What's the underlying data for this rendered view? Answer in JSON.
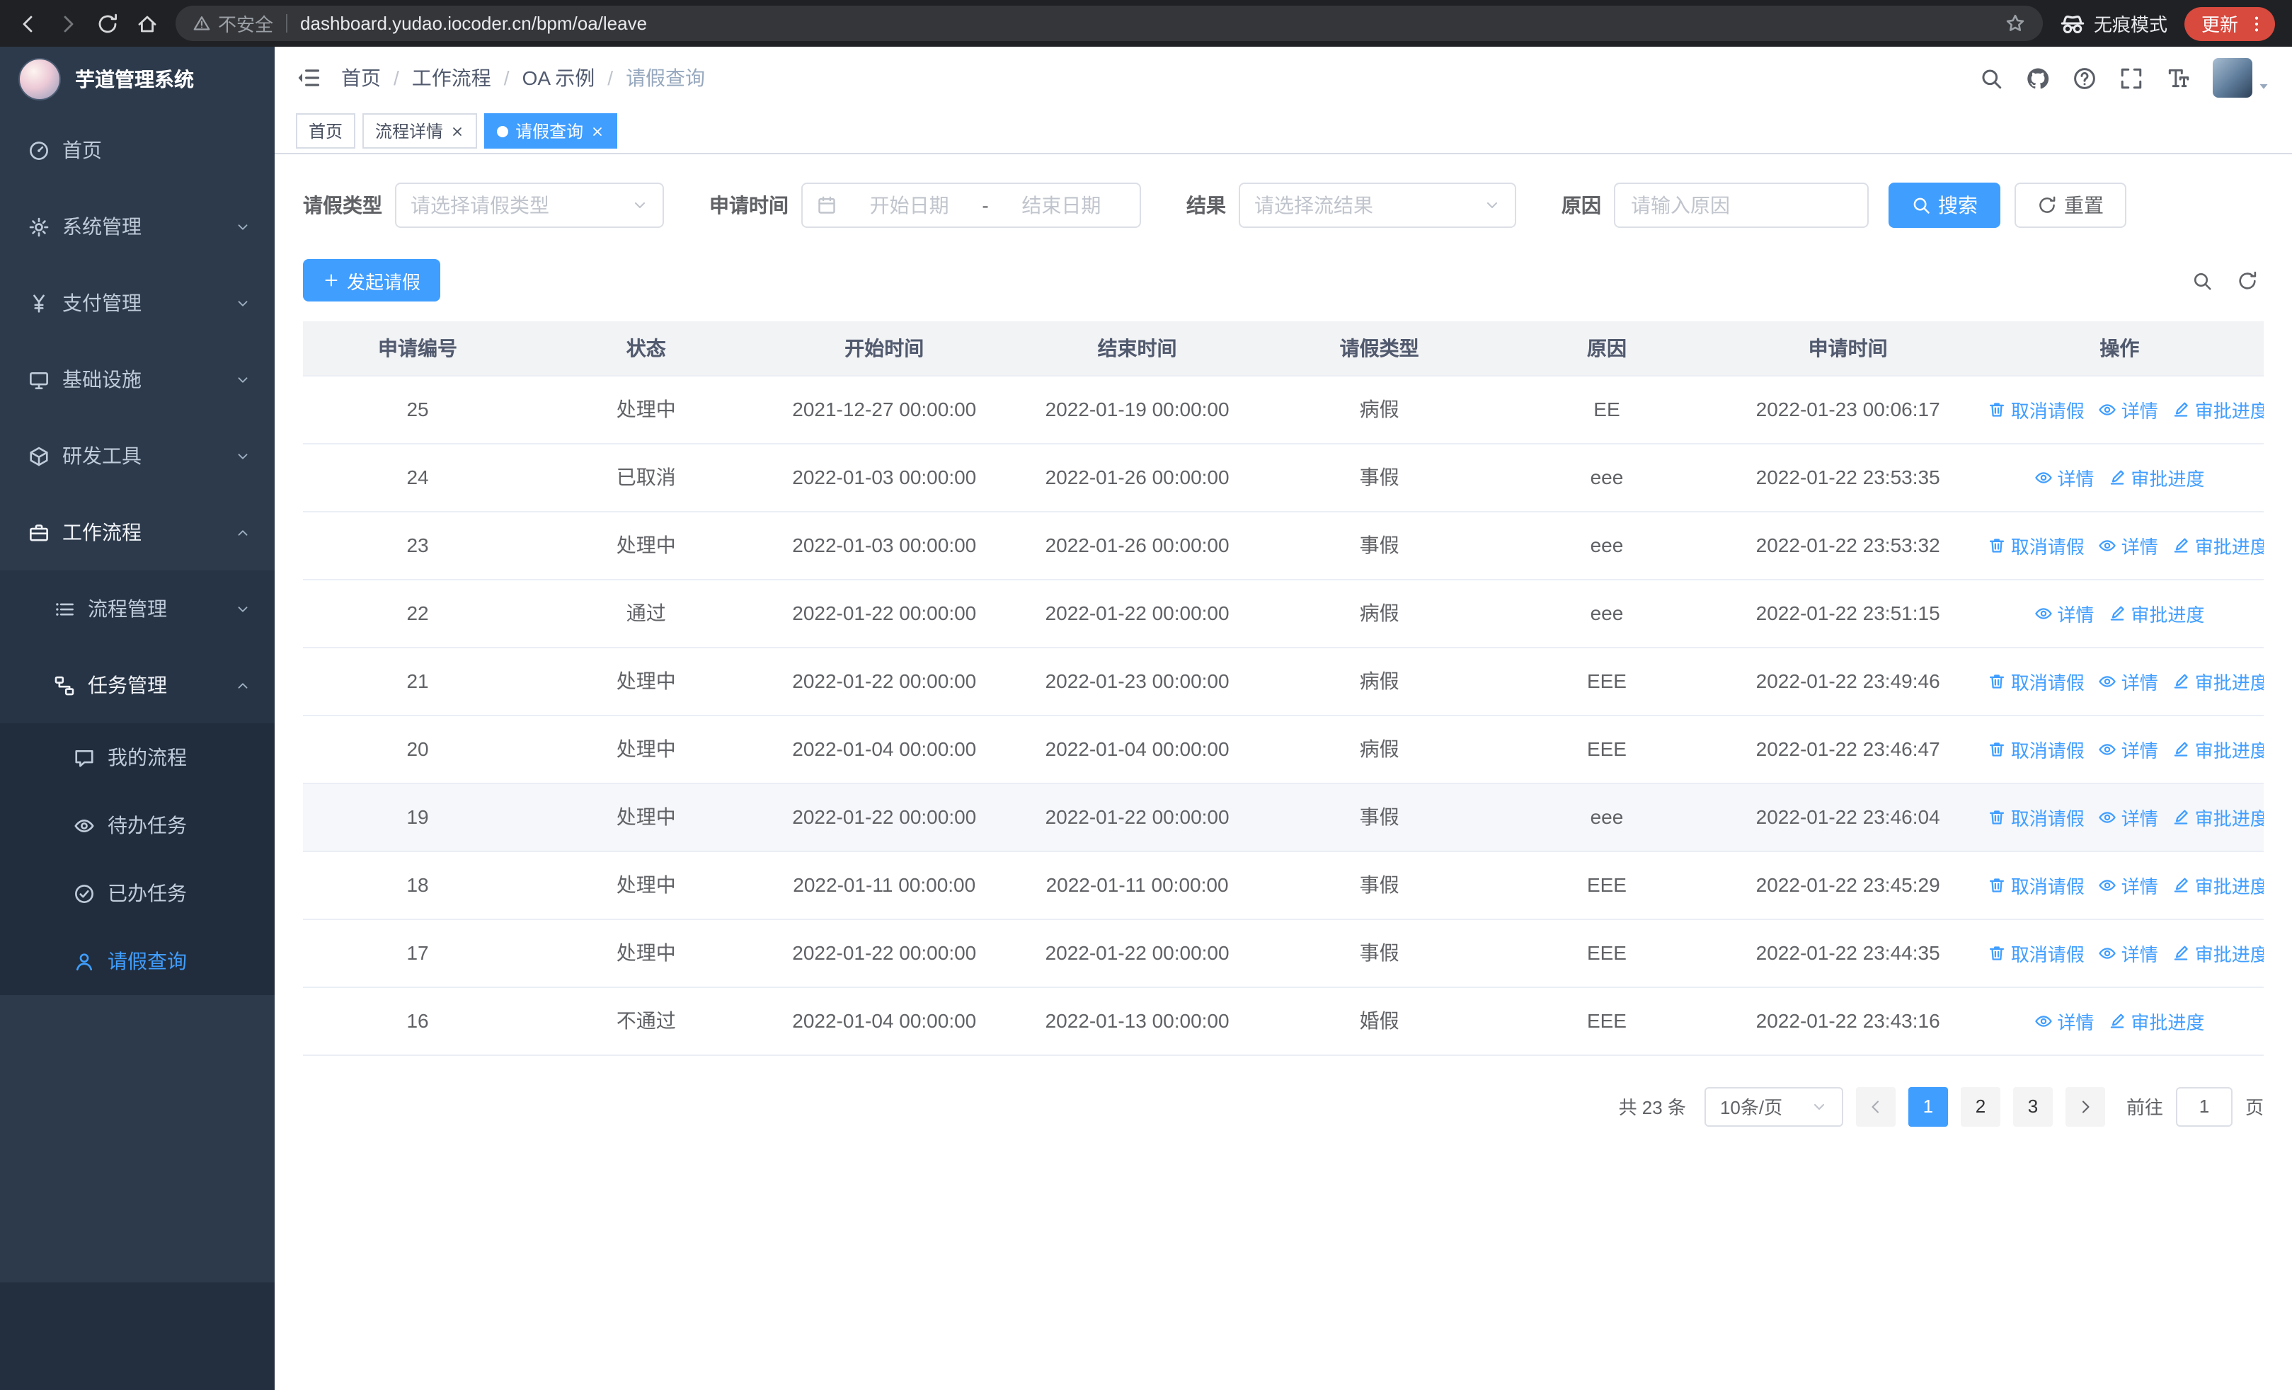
{
  "colors": {
    "primary": "#409eff",
    "sidebar_bg": "#2d3a4b"
  },
  "browser": {
    "security_label": "不安全",
    "url": "dashboard.yudao.iocoder.cn/bpm/oa/leave",
    "incognito_label": "无痕模式",
    "update_label": "更新"
  },
  "sidebar": {
    "title": "芋道管理系统",
    "items": [
      {
        "label": "首页",
        "icon": "dashboard",
        "depth": 1
      },
      {
        "label": "系统管理",
        "icon": "gear",
        "depth": 1,
        "chevron": "down"
      },
      {
        "label": "支付管理",
        "icon": "yen",
        "depth": 1,
        "chevron": "down"
      },
      {
        "label": "基础设施",
        "icon": "monitor",
        "depth": 1,
        "chevron": "down"
      },
      {
        "label": "研发工具",
        "icon": "cube",
        "depth": 1,
        "chevron": "down"
      },
      {
        "label": "工作流程",
        "icon": "briefcase",
        "depth": 1,
        "chevron": "up",
        "open": true
      },
      {
        "label": "流程管理",
        "icon": "list",
        "depth": 2,
        "chevron": "down"
      },
      {
        "label": "任务管理",
        "icon": "flow",
        "depth": 2,
        "chevron": "up",
        "open": true
      },
      {
        "label": "我的流程",
        "icon": "chat",
        "depth": 3
      },
      {
        "label": "待办任务",
        "icon": "eye",
        "depth": 3
      },
      {
        "label": "已办任务",
        "icon": "check",
        "depth": 3
      },
      {
        "label": "请假查询",
        "icon": "user",
        "depth": 3,
        "active": true
      }
    ]
  },
  "header": {
    "separator": "/",
    "breadcrumb": [
      {
        "label": "首页"
      },
      {
        "label": "工作流程"
      },
      {
        "label": "OA 示例"
      },
      {
        "label": "请假查询",
        "current": true
      }
    ]
  },
  "tabs": [
    {
      "label": "首页"
    },
    {
      "label": "流程详情",
      "closable": true
    },
    {
      "label": "请假查询",
      "closable": true,
      "active": true
    }
  ],
  "filters": {
    "leave_type_label": "请假类型",
    "leave_type_placeholder": "请选择请假类型",
    "apply_time_label": "申请时间",
    "start_placeholder": "开始日期",
    "range_separator": "-",
    "end_placeholder": "结束日期",
    "result_label": "结果",
    "result_placeholder": "请选择流结果",
    "reason_label": "原因",
    "reason_placeholder": "请输入原因",
    "search_label": "搜索",
    "reset_label": "重置"
  },
  "toolbar": {
    "create_label": "发起请假"
  },
  "table": {
    "columns": [
      "申请编号",
      "状态",
      "开始时间",
      "结束时间",
      "请假类型",
      "原因",
      "申请时间",
      "操作"
    ],
    "action_labels": {
      "cancel": "取消请假",
      "detail": "详情",
      "progress": "审批进度"
    },
    "rows": [
      {
        "id": "25",
        "status": "处理中",
        "start": "2021-12-27 00:00:00",
        "end": "2022-01-19 00:00:00",
        "type": "病假",
        "reason": "EE",
        "applied": "2022-01-23 00:06:17",
        "actions": [
          "cancel",
          "detail",
          "progress"
        ]
      },
      {
        "id": "24",
        "status": "已取消",
        "start": "2022-01-03 00:00:00",
        "end": "2022-01-26 00:00:00",
        "type": "事假",
        "reason": "eee",
        "applied": "2022-01-22 23:53:35",
        "actions": [
          "detail",
          "progress"
        ]
      },
      {
        "id": "23",
        "status": "处理中",
        "start": "2022-01-03 00:00:00",
        "end": "2022-01-26 00:00:00",
        "type": "事假",
        "reason": "eee",
        "applied": "2022-01-22 23:53:32",
        "actions": [
          "cancel",
          "detail",
          "progress"
        ]
      },
      {
        "id": "22",
        "status": "通过",
        "start": "2022-01-22 00:00:00",
        "end": "2022-01-22 00:00:00",
        "type": "病假",
        "reason": "eee",
        "applied": "2022-01-22 23:51:15",
        "actions": [
          "detail",
          "progress"
        ]
      },
      {
        "id": "21",
        "status": "处理中",
        "start": "2022-01-22 00:00:00",
        "end": "2022-01-23 00:00:00",
        "type": "病假",
        "reason": "EEE",
        "applied": "2022-01-22 23:49:46",
        "actions": [
          "cancel",
          "detail",
          "progress"
        ]
      },
      {
        "id": "20",
        "status": "处理中",
        "start": "2022-01-04 00:00:00",
        "end": "2022-01-04 00:00:00",
        "type": "病假",
        "reason": "EEE",
        "applied": "2022-01-22 23:46:47",
        "actions": [
          "cancel",
          "detail",
          "progress"
        ]
      },
      {
        "id": "19",
        "status": "处理中",
        "start": "2022-01-22 00:00:00",
        "end": "2022-01-22 00:00:00",
        "type": "事假",
        "reason": "eee",
        "applied": "2022-01-22 23:46:04",
        "actions": [
          "cancel",
          "detail",
          "progress"
        ],
        "highlight": true
      },
      {
        "id": "18",
        "status": "处理中",
        "start": "2022-01-11 00:00:00",
        "end": "2022-01-11 00:00:00",
        "type": "事假",
        "reason": "EEE",
        "applied": "2022-01-22 23:45:29",
        "actions": [
          "cancel",
          "detail",
          "progress"
        ]
      },
      {
        "id": "17",
        "status": "处理中",
        "start": "2022-01-22 00:00:00",
        "end": "2022-01-22 00:00:00",
        "type": "事假",
        "reason": "EEE",
        "applied": "2022-01-22 23:44:35",
        "actions": [
          "cancel",
          "detail",
          "progress"
        ]
      },
      {
        "id": "16",
        "status": "不通过",
        "start": "2022-01-04 00:00:00",
        "end": "2022-01-13 00:00:00",
        "type": "婚假",
        "reason": "EEE",
        "applied": "2022-01-22 23:43:16",
        "actions": [
          "detail",
          "progress"
        ]
      }
    ]
  },
  "pagination": {
    "total_text": "共 23 条",
    "page_size": "10条/页",
    "pages": [
      "1",
      "2",
      "3"
    ],
    "active_page": "1",
    "goto_label": "前往",
    "goto_value": "1",
    "goto_suffix": "页"
  }
}
